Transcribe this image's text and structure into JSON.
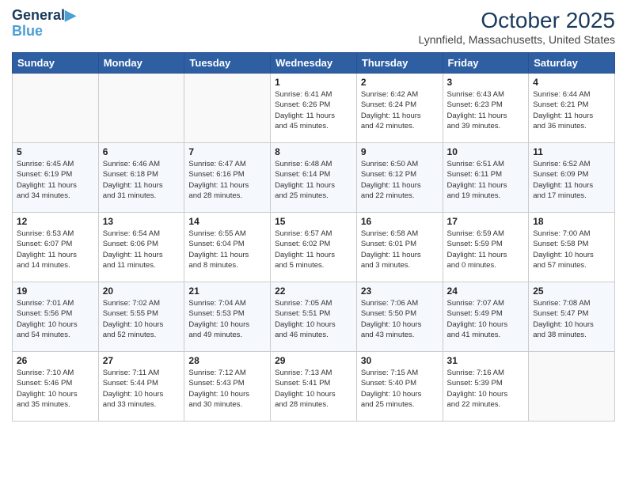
{
  "header": {
    "logo_line1": "General",
    "logo_line2": "Blue",
    "month": "October 2025",
    "location": "Lynnfield, Massachusetts, United States"
  },
  "weekdays": [
    "Sunday",
    "Monday",
    "Tuesday",
    "Wednesday",
    "Thursday",
    "Friday",
    "Saturday"
  ],
  "weeks": [
    [
      {
        "day": "",
        "info": ""
      },
      {
        "day": "",
        "info": ""
      },
      {
        "day": "",
        "info": ""
      },
      {
        "day": "1",
        "info": "Sunrise: 6:41 AM\nSunset: 6:26 PM\nDaylight: 11 hours\nand 45 minutes."
      },
      {
        "day": "2",
        "info": "Sunrise: 6:42 AM\nSunset: 6:24 PM\nDaylight: 11 hours\nand 42 minutes."
      },
      {
        "day": "3",
        "info": "Sunrise: 6:43 AM\nSunset: 6:23 PM\nDaylight: 11 hours\nand 39 minutes."
      },
      {
        "day": "4",
        "info": "Sunrise: 6:44 AM\nSunset: 6:21 PM\nDaylight: 11 hours\nand 36 minutes."
      }
    ],
    [
      {
        "day": "5",
        "info": "Sunrise: 6:45 AM\nSunset: 6:19 PM\nDaylight: 11 hours\nand 34 minutes."
      },
      {
        "day": "6",
        "info": "Sunrise: 6:46 AM\nSunset: 6:18 PM\nDaylight: 11 hours\nand 31 minutes."
      },
      {
        "day": "7",
        "info": "Sunrise: 6:47 AM\nSunset: 6:16 PM\nDaylight: 11 hours\nand 28 minutes."
      },
      {
        "day": "8",
        "info": "Sunrise: 6:48 AM\nSunset: 6:14 PM\nDaylight: 11 hours\nand 25 minutes."
      },
      {
        "day": "9",
        "info": "Sunrise: 6:50 AM\nSunset: 6:12 PM\nDaylight: 11 hours\nand 22 minutes."
      },
      {
        "day": "10",
        "info": "Sunrise: 6:51 AM\nSunset: 6:11 PM\nDaylight: 11 hours\nand 19 minutes."
      },
      {
        "day": "11",
        "info": "Sunrise: 6:52 AM\nSunset: 6:09 PM\nDaylight: 11 hours\nand 17 minutes."
      }
    ],
    [
      {
        "day": "12",
        "info": "Sunrise: 6:53 AM\nSunset: 6:07 PM\nDaylight: 11 hours\nand 14 minutes."
      },
      {
        "day": "13",
        "info": "Sunrise: 6:54 AM\nSunset: 6:06 PM\nDaylight: 11 hours\nand 11 minutes."
      },
      {
        "day": "14",
        "info": "Sunrise: 6:55 AM\nSunset: 6:04 PM\nDaylight: 11 hours\nand 8 minutes."
      },
      {
        "day": "15",
        "info": "Sunrise: 6:57 AM\nSunset: 6:02 PM\nDaylight: 11 hours\nand 5 minutes."
      },
      {
        "day": "16",
        "info": "Sunrise: 6:58 AM\nSunset: 6:01 PM\nDaylight: 11 hours\nand 3 minutes."
      },
      {
        "day": "17",
        "info": "Sunrise: 6:59 AM\nSunset: 5:59 PM\nDaylight: 11 hours\nand 0 minutes."
      },
      {
        "day": "18",
        "info": "Sunrise: 7:00 AM\nSunset: 5:58 PM\nDaylight: 10 hours\nand 57 minutes."
      }
    ],
    [
      {
        "day": "19",
        "info": "Sunrise: 7:01 AM\nSunset: 5:56 PM\nDaylight: 10 hours\nand 54 minutes."
      },
      {
        "day": "20",
        "info": "Sunrise: 7:02 AM\nSunset: 5:55 PM\nDaylight: 10 hours\nand 52 minutes."
      },
      {
        "day": "21",
        "info": "Sunrise: 7:04 AM\nSunset: 5:53 PM\nDaylight: 10 hours\nand 49 minutes."
      },
      {
        "day": "22",
        "info": "Sunrise: 7:05 AM\nSunset: 5:51 PM\nDaylight: 10 hours\nand 46 minutes."
      },
      {
        "day": "23",
        "info": "Sunrise: 7:06 AM\nSunset: 5:50 PM\nDaylight: 10 hours\nand 43 minutes."
      },
      {
        "day": "24",
        "info": "Sunrise: 7:07 AM\nSunset: 5:49 PM\nDaylight: 10 hours\nand 41 minutes."
      },
      {
        "day": "25",
        "info": "Sunrise: 7:08 AM\nSunset: 5:47 PM\nDaylight: 10 hours\nand 38 minutes."
      }
    ],
    [
      {
        "day": "26",
        "info": "Sunrise: 7:10 AM\nSunset: 5:46 PM\nDaylight: 10 hours\nand 35 minutes."
      },
      {
        "day": "27",
        "info": "Sunrise: 7:11 AM\nSunset: 5:44 PM\nDaylight: 10 hours\nand 33 minutes."
      },
      {
        "day": "28",
        "info": "Sunrise: 7:12 AM\nSunset: 5:43 PM\nDaylight: 10 hours\nand 30 minutes."
      },
      {
        "day": "29",
        "info": "Sunrise: 7:13 AM\nSunset: 5:41 PM\nDaylight: 10 hours\nand 28 minutes."
      },
      {
        "day": "30",
        "info": "Sunrise: 7:15 AM\nSunset: 5:40 PM\nDaylight: 10 hours\nand 25 minutes."
      },
      {
        "day": "31",
        "info": "Sunrise: 7:16 AM\nSunset: 5:39 PM\nDaylight: 10 hours\nand 22 minutes."
      },
      {
        "day": "",
        "info": ""
      }
    ]
  ]
}
